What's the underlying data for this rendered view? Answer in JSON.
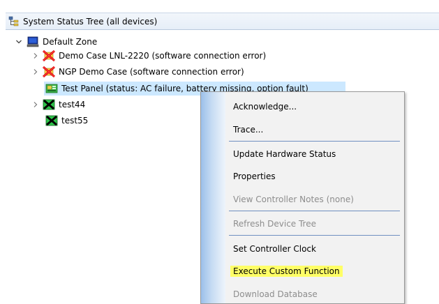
{
  "window": {
    "title": "System Status Tree (all devices)"
  },
  "tree": {
    "root": {
      "label": "Default Zone",
      "expanded": true
    },
    "items": [
      {
        "label": "Demo Case LNL-2220 (software connection error)",
        "icon": "controller-error-icon"
      },
      {
        "label": "NGP Demo Case (software connection error)",
        "icon": "controller-error-icon"
      },
      {
        "label": "Test Panel (status: AC failure, battery missing, option fault)",
        "icon": "panel-icon",
        "selected": true
      },
      {
        "label": "test44",
        "icon": "controller-offline-icon"
      },
      {
        "label": "test55",
        "icon": "controller-offline-icon"
      }
    ]
  },
  "context_menu": {
    "items": [
      {
        "label": "Acknowledge...",
        "enabled": true
      },
      {
        "label": "Trace...",
        "enabled": true
      },
      {
        "label": "Update Hardware Status",
        "enabled": true
      },
      {
        "label": "Properties",
        "enabled": true
      },
      {
        "label": "View Controller Notes (none)",
        "enabled": false
      },
      {
        "label": "Refresh Device Tree",
        "enabled": false
      },
      {
        "label": "Set Controller Clock",
        "enabled": true
      },
      {
        "label": "Execute Custom Function",
        "enabled": true,
        "highlighted": true
      },
      {
        "label": "Download Database",
        "enabled": false
      }
    ]
  },
  "colors": {
    "selection": "#cce8ff",
    "highlight": "#ffff66",
    "menu_background": "#f2f2f2",
    "disabled_text": "#8d8d8d"
  }
}
